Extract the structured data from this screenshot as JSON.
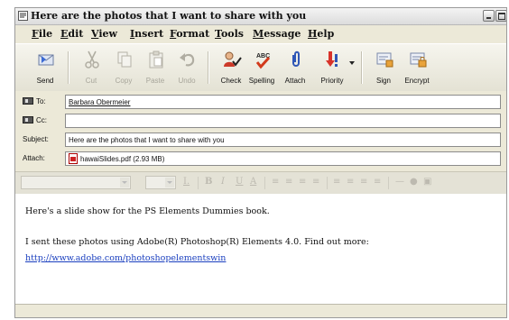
{
  "window": {
    "title": "Here are the photos that I want to share with you"
  },
  "menu": [
    "File",
    "Edit",
    "View",
    "Insert",
    "Format",
    "Tools",
    "Message",
    "Help"
  ],
  "toolbar": {
    "send": "Send",
    "cut": "Cut",
    "copy": "Copy",
    "paste": "Paste",
    "undo": "Undo",
    "check": "Check",
    "spelling": "Spelling",
    "attach": "Attach",
    "priority": "Priority",
    "sign": "Sign",
    "encrypt": "Encrypt"
  },
  "fields": {
    "to_label": "To:",
    "to_value": "Barbara Obermeier",
    "cc_label": "Cc:",
    "cc_value": "",
    "subject_label": "Subject:",
    "subject_value": "Here are the photos that I want to share with you",
    "attach_label": "Attach:",
    "attach_value": "hawaiSlides.pdf (2.93 MB)"
  },
  "body": {
    "line1": "Here's a slide show for the PS Elements Dummies book.",
    "line2": "I sent these photos using Adobe(R) Photoshop(R) Elements 4.0. Find out more:",
    "link": "http://www.adobe.com/photoshopelementswin"
  },
  "colors": {
    "link": "#1a3fbf",
    "chrome": "#ece9d8"
  }
}
